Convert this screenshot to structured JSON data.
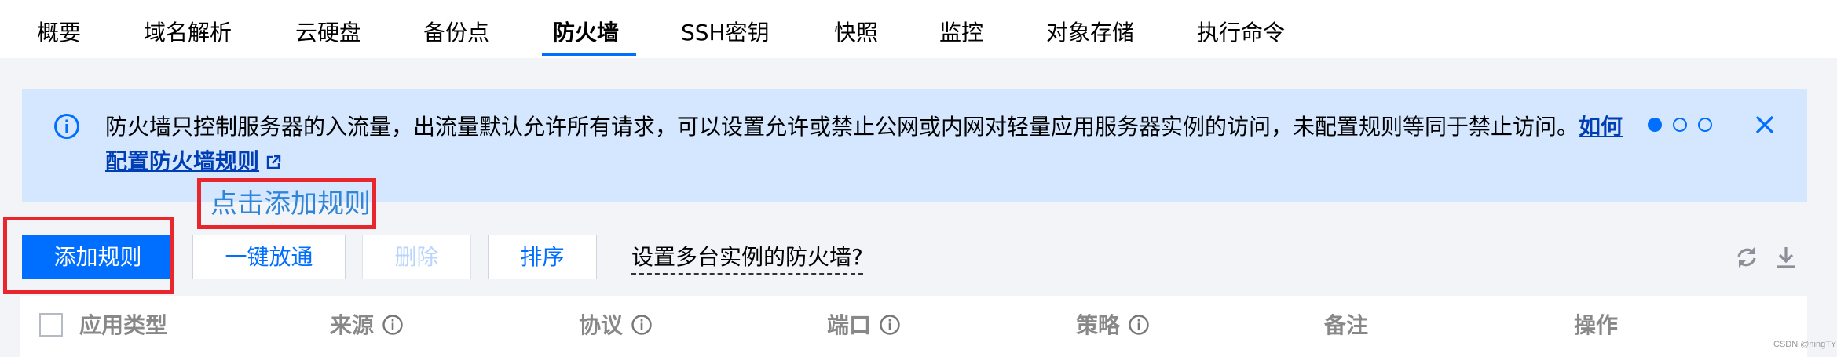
{
  "tabs": [
    {
      "label": "概要",
      "active": false
    },
    {
      "label": "域名解析",
      "active": false
    },
    {
      "label": "云硬盘",
      "active": false
    },
    {
      "label": "备份点",
      "active": false
    },
    {
      "label": "防火墙",
      "active": true
    },
    {
      "label": "SSH密钥",
      "active": false
    },
    {
      "label": "快照",
      "active": false
    },
    {
      "label": "监控",
      "active": false
    },
    {
      "label": "对象存储",
      "active": false
    },
    {
      "label": "执行命令",
      "active": false
    }
  ],
  "notice": {
    "text": "防火墙只控制服务器的入流量，出流量默认允许所有请求，可以设置允许或禁止公网或内网对轻量应用服务器实例的访问，未配置规则等同于禁止访问。",
    "link": "如何配置防火墙规则",
    "pager": {
      "current": 1,
      "total": 3
    }
  },
  "callout": {
    "text": "点击添加规则"
  },
  "toolbar": {
    "add_rule": "添加规则",
    "one_click_allow": "一键放通",
    "delete": "删除",
    "sort": "排序",
    "multi_instance_link": "设置多台实例的防火墙?"
  },
  "table": {
    "columns": [
      {
        "label": "应用类型",
        "info": false
      },
      {
        "label": "来源",
        "info": true
      },
      {
        "label": "协议",
        "info": true
      },
      {
        "label": "端口",
        "info": true
      },
      {
        "label": "策略",
        "info": true
      },
      {
        "label": "备注",
        "info": false
      },
      {
        "label": "操作",
        "info": false
      }
    ]
  },
  "watermark": "CSDN @ningTY",
  "colors": {
    "accent": "#006eff",
    "notice_bg": "#d5e7ff",
    "highlight": "#e8262b",
    "callout_text": "#2f85d8"
  },
  "icons": [
    "info-icon",
    "external-link-icon",
    "close-icon",
    "refresh-icon",
    "download-icon",
    "info-circle-icon"
  ]
}
